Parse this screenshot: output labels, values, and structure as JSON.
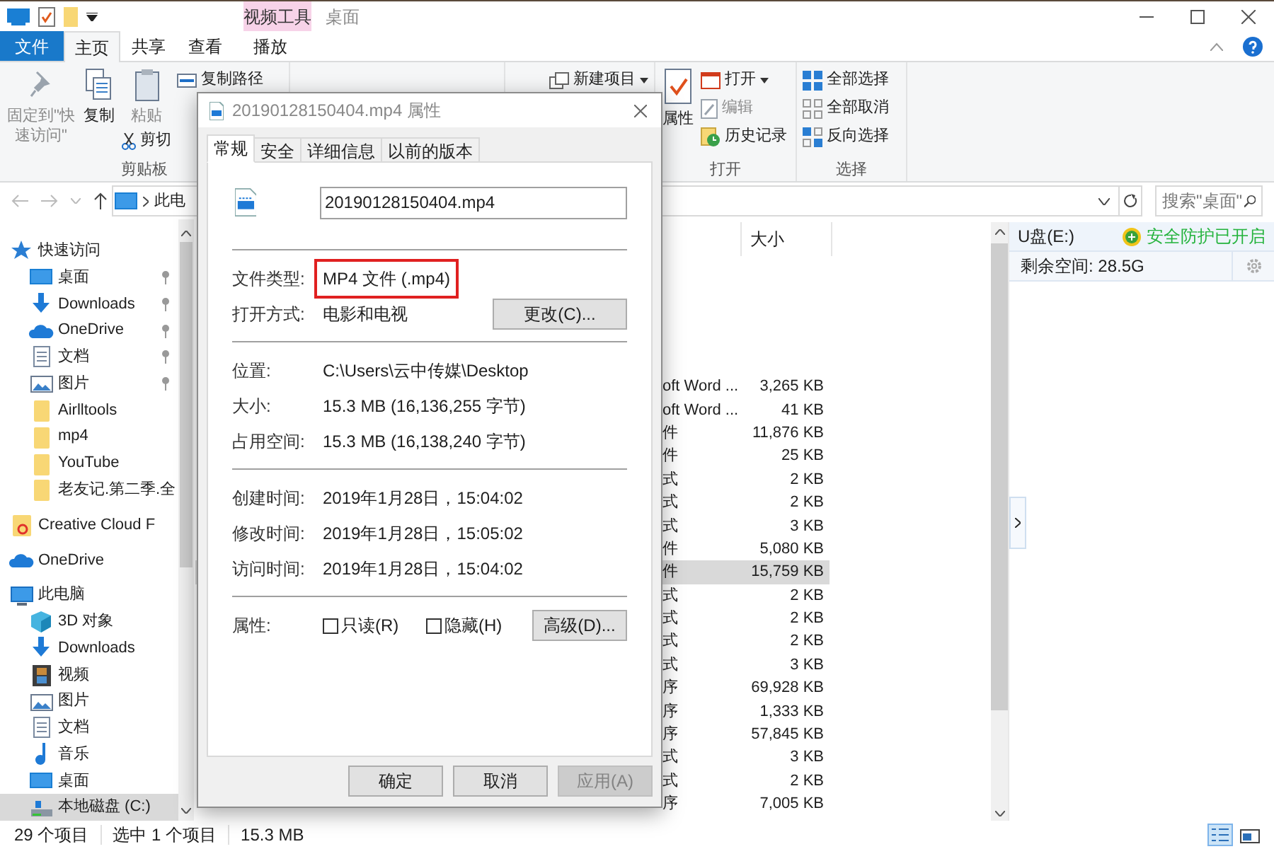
{
  "window": {
    "contextual_tab": "视频工具",
    "title": "桌面"
  },
  "ribbon_tabs": [
    {
      "label": "文件",
      "kind": "file",
      "selected": false
    },
    {
      "label": "主页",
      "kind": "tab",
      "selected": true
    },
    {
      "label": "共享",
      "kind": "tab",
      "selected": false
    },
    {
      "label": "查看",
      "kind": "tab",
      "selected": false
    },
    {
      "label": "播放",
      "kind": "contextual",
      "selected": false
    }
  ],
  "ribbon": {
    "clipboard": {
      "pin": {
        "label": "固定到\"快速访问\"",
        "disabled": true
      },
      "copy": {
        "label": "复制",
        "disabled": false
      },
      "paste": {
        "label": "粘贴",
        "disabled": true
      },
      "copy_path": "复制路径",
      "cut": "剪切",
      "label": "剪贴板"
    },
    "new": {
      "new_item": "新建项目"
    },
    "open": {
      "properties": "属性",
      "open": "打开",
      "edit": {
        "label": "编辑",
        "disabled": true
      },
      "history": "历史记录",
      "label": "打开"
    },
    "select": {
      "select_all": "全部选择",
      "select_none": "全部取消",
      "invert": "反向选择",
      "label": "选择"
    }
  },
  "address_bar": {
    "path": "此电",
    "search_placeholder": "搜索\"桌面\""
  },
  "nav_tree": [
    {
      "label": "快速访问",
      "kind": "star",
      "selected": false,
      "children": [
        {
          "label": "桌面",
          "kind": "desktop",
          "pinned": true,
          "selected": false
        },
        {
          "label": "Downloads",
          "kind": "download",
          "pinned": true,
          "selected": false
        },
        {
          "label": "OneDrive",
          "kind": "cloud",
          "pinned": true,
          "selected": false
        },
        {
          "label": "文档",
          "kind": "document",
          "pinned": true,
          "selected": false
        },
        {
          "label": "图片",
          "kind": "picture",
          "pinned": true,
          "selected": false
        },
        {
          "label": "Airlltools",
          "kind": "folder",
          "pinned": false,
          "selected": false
        },
        {
          "label": "mp4",
          "kind": "folder",
          "pinned": false,
          "selected": false
        },
        {
          "label": "YouTube",
          "kind": "folder",
          "pinned": false,
          "selected": false
        },
        {
          "label": "老友记.第二季.全",
          "kind": "folder",
          "pinned": false,
          "selected": false
        }
      ]
    },
    {
      "label": "Creative Cloud F",
      "kind": "cc-folder",
      "selected": false
    },
    {
      "label": "OneDrive",
      "kind": "cloud",
      "selected": false
    },
    {
      "label": "此电脑",
      "kind": "pc",
      "selected": false,
      "children": [
        {
          "label": "3D 对象",
          "kind": "cube",
          "selected": false
        },
        {
          "label": "Downloads",
          "kind": "download",
          "selected": false
        },
        {
          "label": "视频",
          "kind": "video",
          "selected": false
        },
        {
          "label": "图片",
          "kind": "picture",
          "selected": false
        },
        {
          "label": "文档",
          "kind": "document",
          "selected": false
        },
        {
          "label": "音乐",
          "kind": "music",
          "selected": false
        },
        {
          "label": "桌面",
          "kind": "desktop",
          "selected": false
        },
        {
          "label": "本地磁盘 (C:)",
          "kind": "drive",
          "selected": true
        }
      ]
    }
  ],
  "file_list": {
    "columns": [
      "大小"
    ],
    "rows": [
      {
        "column_type": "oft Word ...",
        "size": "3,265 KB",
        "selected": false
      },
      {
        "column_type": "oft Word ...",
        "size": "41 KB",
        "selected": false
      },
      {
        "column_type": "件",
        "size": "11,876 KB",
        "selected": false
      },
      {
        "column_type": "件",
        "size": "25 KB",
        "selected": false
      },
      {
        "column_type": "式",
        "size": "2 KB",
        "selected": false
      },
      {
        "column_type": "式",
        "size": "2 KB",
        "selected": false
      },
      {
        "column_type": "式",
        "size": "3 KB",
        "selected": false
      },
      {
        "column_type": "件",
        "size": "5,080 KB",
        "selected": false
      },
      {
        "column_type": "件",
        "size": "15,759 KB",
        "selected": true
      },
      {
        "column_type": "式",
        "size": "2 KB",
        "selected": false
      },
      {
        "column_type": "式",
        "size": "2 KB",
        "selected": false
      },
      {
        "column_type": "式",
        "size": "2 KB",
        "selected": false
      },
      {
        "column_type": "式",
        "size": "3 KB",
        "selected": false
      },
      {
        "column_type": "序",
        "size": "69,928 KB",
        "selected": false
      },
      {
        "column_type": "序",
        "size": "1,333 KB",
        "selected": false
      },
      {
        "column_type": "序",
        "size": "57,845 KB",
        "selected": false
      },
      {
        "column_type": "式",
        "size": "3 KB",
        "selected": false
      },
      {
        "column_type": "式",
        "size": "2 KB",
        "selected": false
      },
      {
        "column_type": "序",
        "size": "7,005 KB",
        "selected": false
      }
    ]
  },
  "drive_panel": {
    "drive": "U盘(E:)",
    "protection": "安全防护已开启",
    "free_space": "剩余空间: 28.5G"
  },
  "status_bar": {
    "items": [
      "29 个项目",
      "选中 1 个项目",
      "15.3 MB"
    ],
    "views": [
      {
        "kind": "details",
        "selected": true
      },
      {
        "kind": "thumbnails",
        "selected": false
      }
    ]
  },
  "dialog": {
    "title": "20190128150404.mp4 属性",
    "tabs": [
      {
        "label": "常规",
        "selected": true
      },
      {
        "label": "安全",
        "selected": false
      },
      {
        "label": "详细信息",
        "selected": false
      },
      {
        "label": "以前的版本",
        "selected": false
      }
    ],
    "file_name": "20190128150404.mp4",
    "sections": [
      [
        {
          "label": "文件类型:",
          "value": "MP4 文件 (.mp4)",
          "highlighted": true
        },
        {
          "label": "打开方式:",
          "value": "电影和电视",
          "highlighted": false,
          "button": "更改(C)..."
        }
      ],
      [
        {
          "label": "位置:",
          "value": "C:\\Users\\云中传媒\\Desktop",
          "highlighted": false
        },
        {
          "label": "大小:",
          "value": "15.3 MB (16,136,255 字节)",
          "highlighted": false
        },
        {
          "label": "占用空间:",
          "value": "15.3 MB (16,138,240 字节)",
          "highlighted": false
        }
      ],
      [
        {
          "label": "创建时间:",
          "value": "2019年1月28日，15:04:02",
          "highlighted": false
        },
        {
          "label": "修改时间:",
          "value": "2019年1月28日，15:05:02",
          "highlighted": false
        },
        {
          "label": "访问时间:",
          "value": "2019年1月28日，15:04:02",
          "highlighted": false
        }
      ]
    ],
    "attributes": {
      "label": "属性:",
      "checkboxes": [
        {
          "label": "只读(R)",
          "checked": false
        },
        {
          "label": "隐藏(H)",
          "checked": false
        }
      ],
      "advanced": "高级(D)..."
    },
    "buttons": [
      {
        "label": "确定",
        "disabled": false
      },
      {
        "label": "取消",
        "disabled": false
      },
      {
        "label": "应用(A)",
        "disabled": true
      }
    ]
  }
}
